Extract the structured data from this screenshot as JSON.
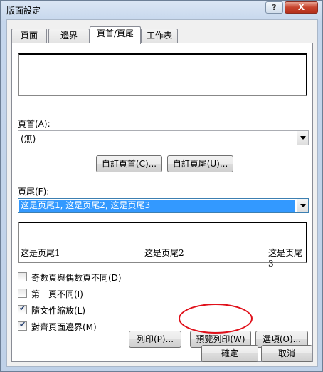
{
  "window": {
    "title": "版面設定",
    "help": "?",
    "close": "X"
  },
  "tabs": [
    {
      "label": "頁面"
    },
    {
      "label": "邊界"
    },
    {
      "label": "頁首/頁尾"
    },
    {
      "label": "工作表"
    }
  ],
  "header": {
    "label": "頁首(A):",
    "value": "(無)",
    "custom_header_button": "自訂頁首(C)...",
    "custom_footer_button": "自訂頁尾(U)..."
  },
  "footer": {
    "label": "頁尾(F):",
    "value": "这是页尾1, 这是页尾2, 这是页尾3",
    "preview_left": "这是页尾1",
    "preview_center": "这是页尾2",
    "preview_right": "这是页尾3"
  },
  "options": [
    {
      "label": "奇數頁與偶數頁不同(D)",
      "checked": false
    },
    {
      "label": "第一頁不同(I)",
      "checked": false
    },
    {
      "label": "隨文件縮放(L)",
      "checked": true
    },
    {
      "label": "對齊頁面邊界(M)",
      "checked": true
    }
  ],
  "buttons": {
    "print": "列印(P)...",
    "preview": "預覽列印(W)",
    "options": "選項(O)...",
    "ok": "確定",
    "cancel": "取消"
  }
}
